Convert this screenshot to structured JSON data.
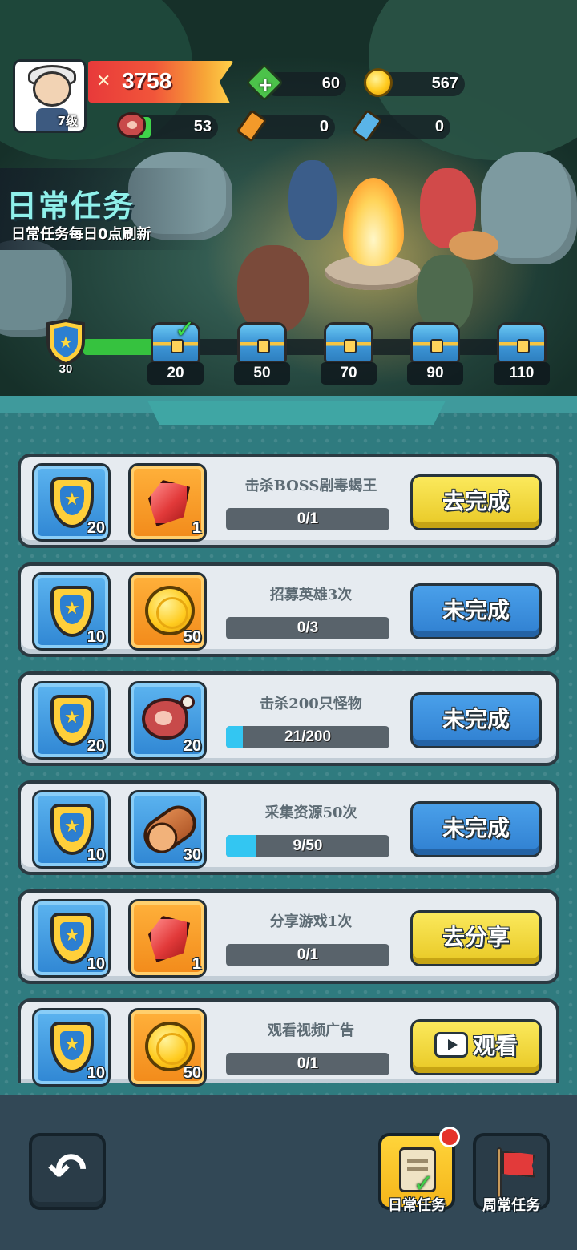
{
  "header": {
    "avatar_level": "7级",
    "combat_power": "3758",
    "resources": {
      "gems": "60",
      "gold": "567",
      "stamina": "53",
      "red_ticket": "0",
      "blue_ticket": "0"
    },
    "title": "日常任务",
    "subtitle": "日常任务每日0点刷新"
  },
  "progress": {
    "current_points": "30",
    "max_points": 110,
    "current_value": 30,
    "milestones": [
      {
        "points": "20",
        "claimed": true
      },
      {
        "points": "50",
        "claimed": false
      },
      {
        "points": "70",
        "claimed": false
      },
      {
        "points": "90",
        "claimed": false
      },
      {
        "points": "110",
        "claimed": false
      }
    ]
  },
  "tasks": [
    {
      "title": "击杀BOSS剧毒蝎王",
      "points": "20",
      "reward_icon": "ruby-icon",
      "reward_count": "1",
      "progress_text": "0/1",
      "progress": 0,
      "button": "去完成",
      "button_style": "yellow"
    },
    {
      "title": "招募英雄3次",
      "points": "10",
      "reward_icon": "gold-coin-icon",
      "reward_count": "50",
      "progress_text": "0/3",
      "progress": 0,
      "button": "未完成",
      "button_style": "blue"
    },
    {
      "title": "击杀200只怪物",
      "points": "20",
      "reward_icon": "meat-icon",
      "reward_count": "20",
      "progress_text": "21/200",
      "progress": 0.105,
      "button": "未完成",
      "button_style": "blue"
    },
    {
      "title": "采集资源50次",
      "points": "10",
      "reward_icon": "wood-log-icon",
      "reward_count": "30",
      "progress_text": "9/50",
      "progress": 0.18,
      "button": "未完成",
      "button_style": "blue"
    },
    {
      "title": "分享游戏1次",
      "points": "10",
      "reward_icon": "ruby-icon",
      "reward_count": "1",
      "progress_text": "0/1",
      "progress": 0,
      "button": "去分享",
      "button_style": "yellow"
    },
    {
      "title": "观看视频广告",
      "points": "10",
      "reward_icon": "gold-coin-icon",
      "reward_count": "50",
      "progress_text": "0/1",
      "progress": 0,
      "button": "观看",
      "button_style": "yellow"
    }
  ],
  "bottom_nav": {
    "daily_label": "日常任务",
    "weekly_label": "周常任务",
    "back_icon": "back-arrow-icon"
  },
  "colors": {
    "accent_green": "#36c23f",
    "button_yellow": "#f3db3c",
    "button_blue": "#3a8fde",
    "progress_cyan": "#33c6f2"
  }
}
